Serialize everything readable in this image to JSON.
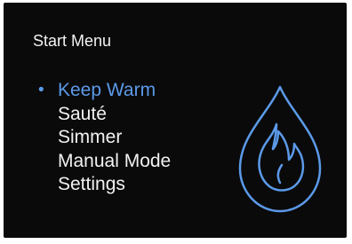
{
  "menu": {
    "title": "Start Menu",
    "items": [
      {
        "label": "Keep Warm",
        "selected": true
      },
      {
        "label": "Sauté",
        "selected": false
      },
      {
        "label": "Simmer",
        "selected": false
      },
      {
        "label": "Manual Mode",
        "selected": false
      },
      {
        "label": "Settings",
        "selected": false
      }
    ]
  },
  "icon": {
    "name": "flame-icon",
    "color": "#5b9ae8"
  },
  "colors": {
    "background": "#0a0a0a",
    "text": "#f2f2f2",
    "accent": "#5b9ae8"
  }
}
